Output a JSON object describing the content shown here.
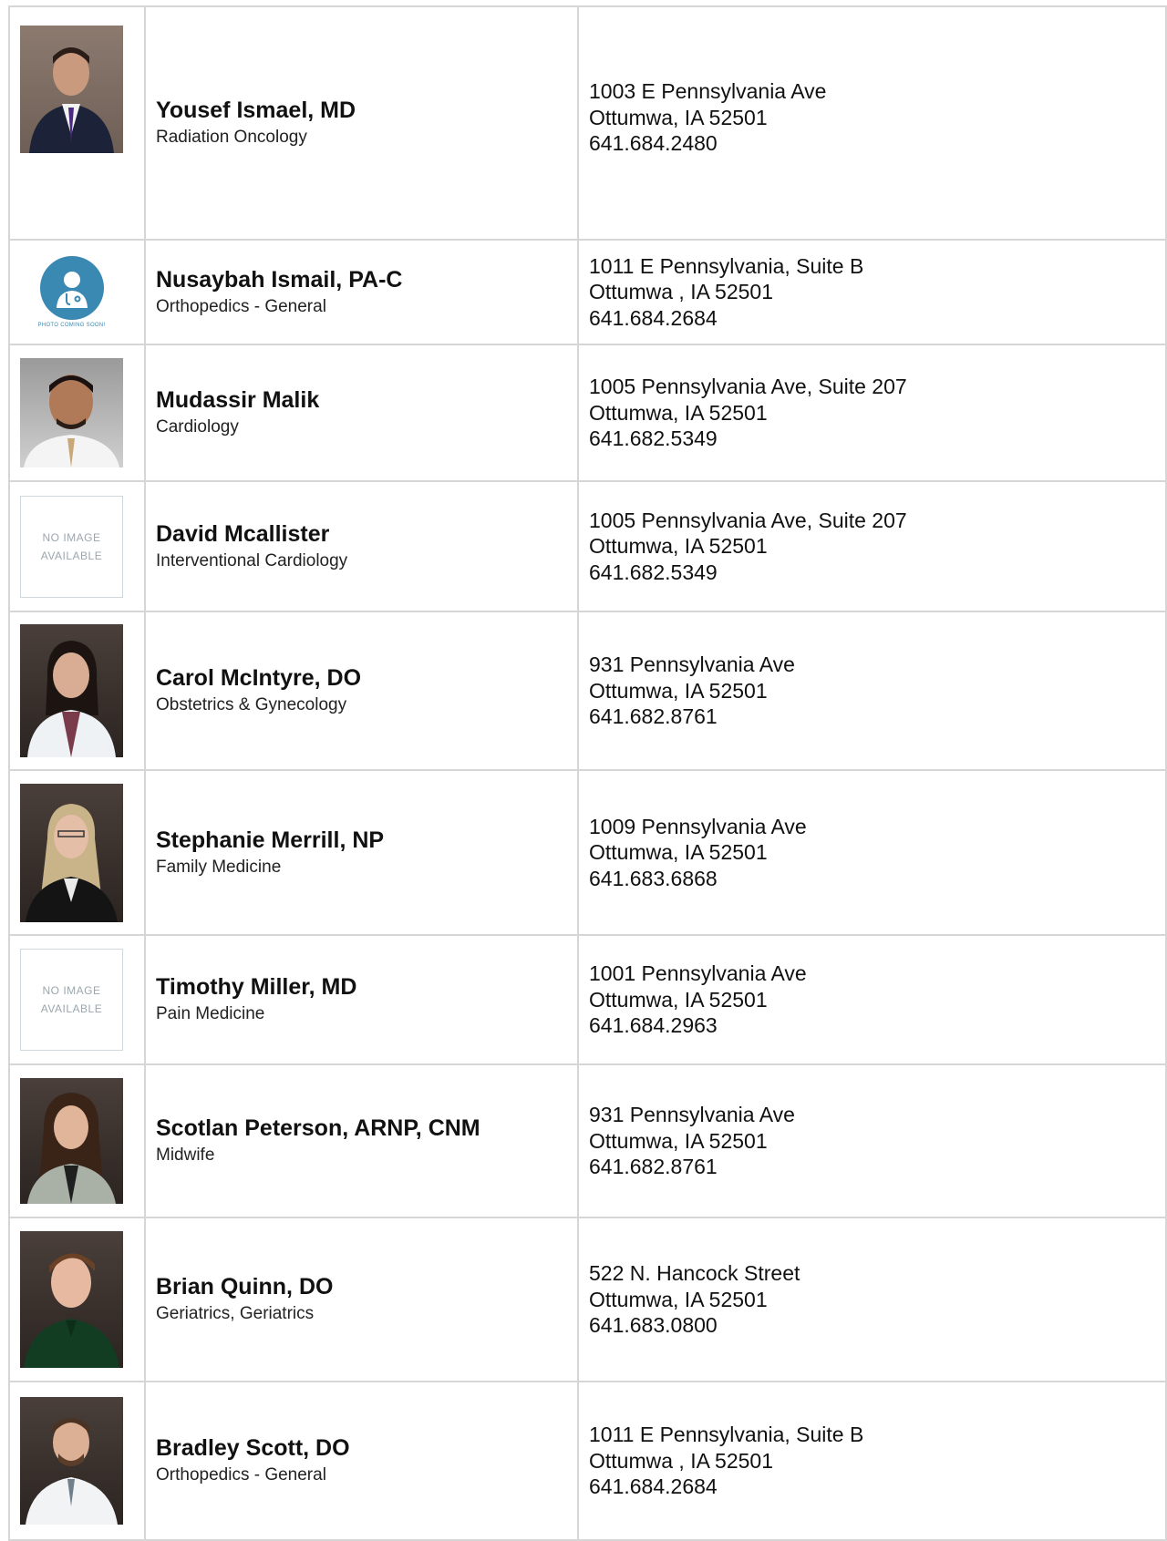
{
  "no_image_text": {
    "line1": "NO IMAGE",
    "line2": "AVAILABLE"
  },
  "photo_coming_soon": "PHOTO COMING SOON!",
  "providers": [
    {
      "name": "Yousef Ismael, MD",
      "specialty": "Radiation Oncology",
      "address1": "1003 E Pennsylvania Ave",
      "address2": "Ottumwa, IA 52501",
      "phone": "641.684.2480"
    },
    {
      "name": "Nusaybah Ismail, PA-C",
      "specialty": "Orthopedics - General",
      "address1": "1011 E Pennsylvania, Suite B",
      "address2": "Ottumwa , IA 52501",
      "phone": "641.684.2684"
    },
    {
      "name": "Mudassir Malik",
      "specialty": "Cardiology",
      "address1": "1005 Pennsylvania Ave, Suite 207",
      "address2": "Ottumwa, IA 52501",
      "phone": "641.682.5349"
    },
    {
      "name": "David Mcallister",
      "specialty": "Interventional Cardiology",
      "address1": "1005 Pennsylvania Ave, Suite 207",
      "address2": "Ottumwa, IA 52501",
      "phone": "641.682.5349"
    },
    {
      "name": "Carol McIntyre, DO",
      "specialty": "Obstetrics & Gynecology",
      "address1": "931 Pennsylvania Ave",
      "address2": "Ottumwa, IA 52501",
      "phone": "641.682.8761"
    },
    {
      "name": "Stephanie Merrill, NP",
      "specialty": "Family Medicine",
      "address1": "1009 Pennsylvania Ave",
      "address2": "Ottumwa, IA 52501",
      "phone": "641.683.6868"
    },
    {
      "name": "Timothy Miller, MD",
      "specialty": "Pain Medicine",
      "address1": "1001 Pennsylvania Ave",
      "address2": "Ottumwa, IA 52501",
      "phone": "641.684.2963"
    },
    {
      "name": "Scotlan Peterson, ARNP, CNM",
      "specialty": "Midwife",
      "address1": "931 Pennsylvania Ave",
      "address2": "Ottumwa, IA 52501",
      "phone": "641.682.8761"
    },
    {
      "name": "Brian Quinn, DO",
      "specialty": "Geriatrics, Geriatrics",
      "address1": "522 N. Hancock Street",
      "address2": "Ottumwa, IA 52501",
      "phone": "641.683.0800"
    },
    {
      "name": "Bradley Scott, DO",
      "specialty": "Orthopedics - General",
      "address1": "1011 E Pennsylvania, Suite B",
      "address2": "Ottumwa , IA 52501",
      "phone": "641.684.2684"
    }
  ]
}
